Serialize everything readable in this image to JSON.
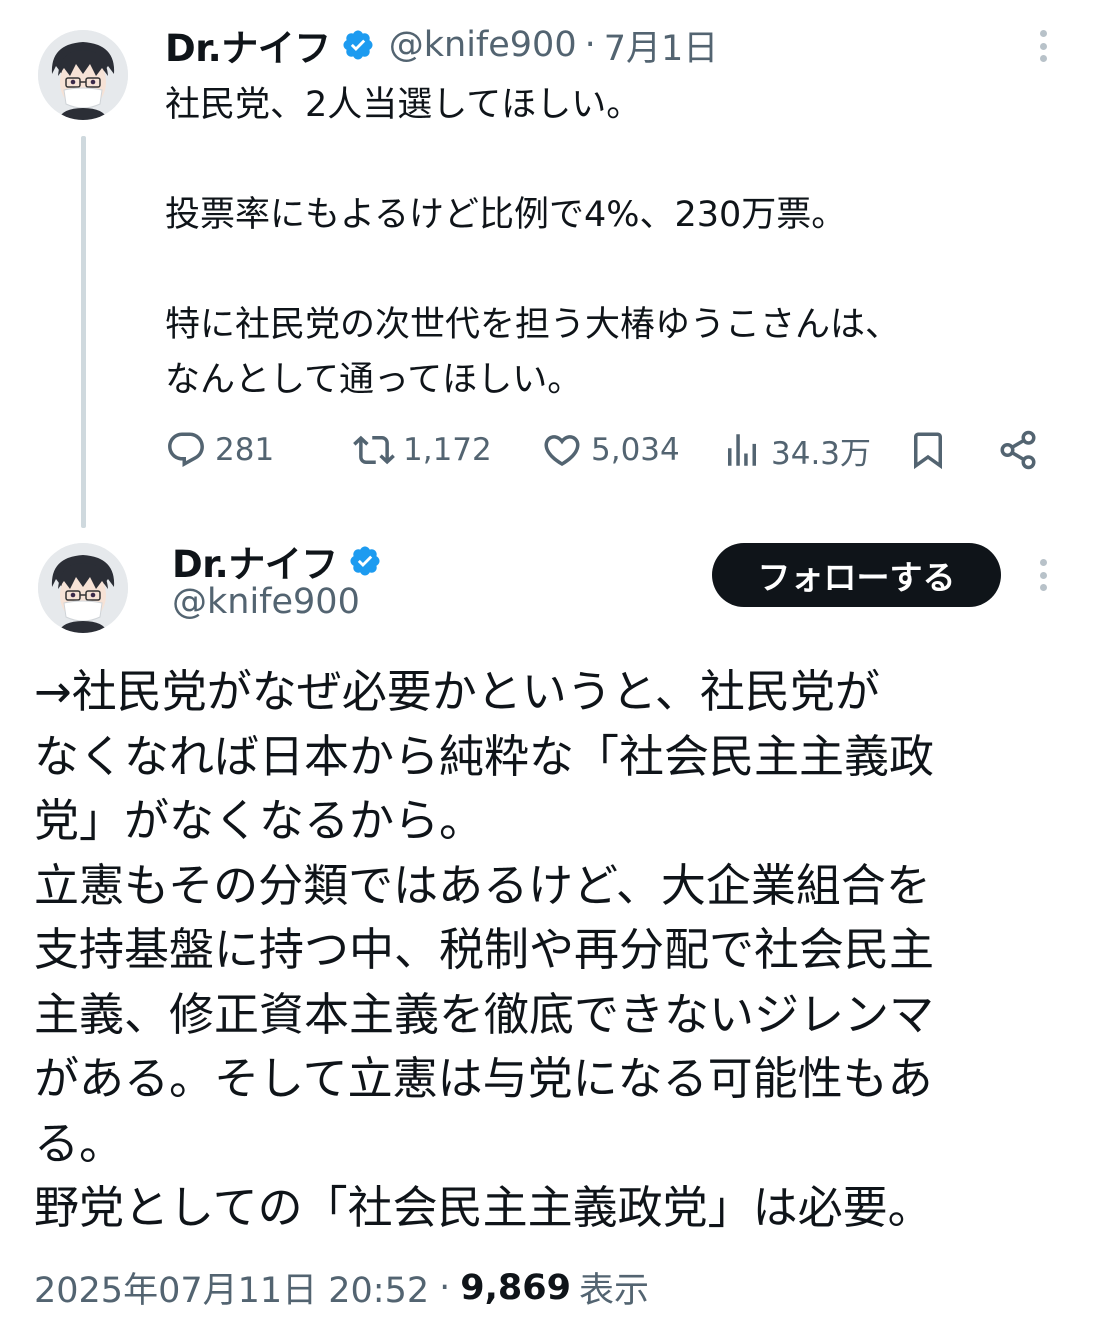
{
  "reply_tweet": {
    "author_name": "Dr.ナイフ",
    "handle": "@knife900",
    "separator": "·",
    "date": "7月1日",
    "lines": [
      "社民党、2人当選してほしい。",
      "",
      "投票率にもよるけど比例で4%、230万票。",
      "",
      "特に社民党の次世代を担う大椿ゆうこさんは、",
      "なんとして通ってほしい。"
    ],
    "stats": {
      "replies": "281",
      "reposts": "1,172",
      "likes": "5,034",
      "views": "34.3万"
    },
    "icons": [
      "reply-icon",
      "repost-icon",
      "like-icon",
      "views-icon",
      "bookmark-icon",
      "share-icon"
    ]
  },
  "main_tweet": {
    "author_name": "Dr.ナイフ",
    "handle": "@knife900",
    "follow_label": "フォローする",
    "lines": [
      "→社民党がなぜ必要かというと、社民党が",
      "なくなれば日本から純粋な「社会民主主義政",
      "党」がなくなるから。",
      "立憲もその分類ではあるけど、大企業組合を",
      "支持基盤に持つ中、税制や再分配で社会民主",
      "主義、修正資本主義を徹底できないジレンマ",
      "がある。そして立憲は与党になる可能性もあ",
      "る。",
      "野党としての「社会民主主義政党」は必要。"
    ],
    "timestamp": "2025年07月11日 20:52",
    "separator": "·",
    "view_count": "9,869",
    "view_label": "表示"
  },
  "colors": {
    "text": "#0f1419",
    "secondary": "#536471",
    "verified": "#1d9bf0",
    "thread_line": "#cfd9de",
    "button_bg": "#0f1419"
  }
}
